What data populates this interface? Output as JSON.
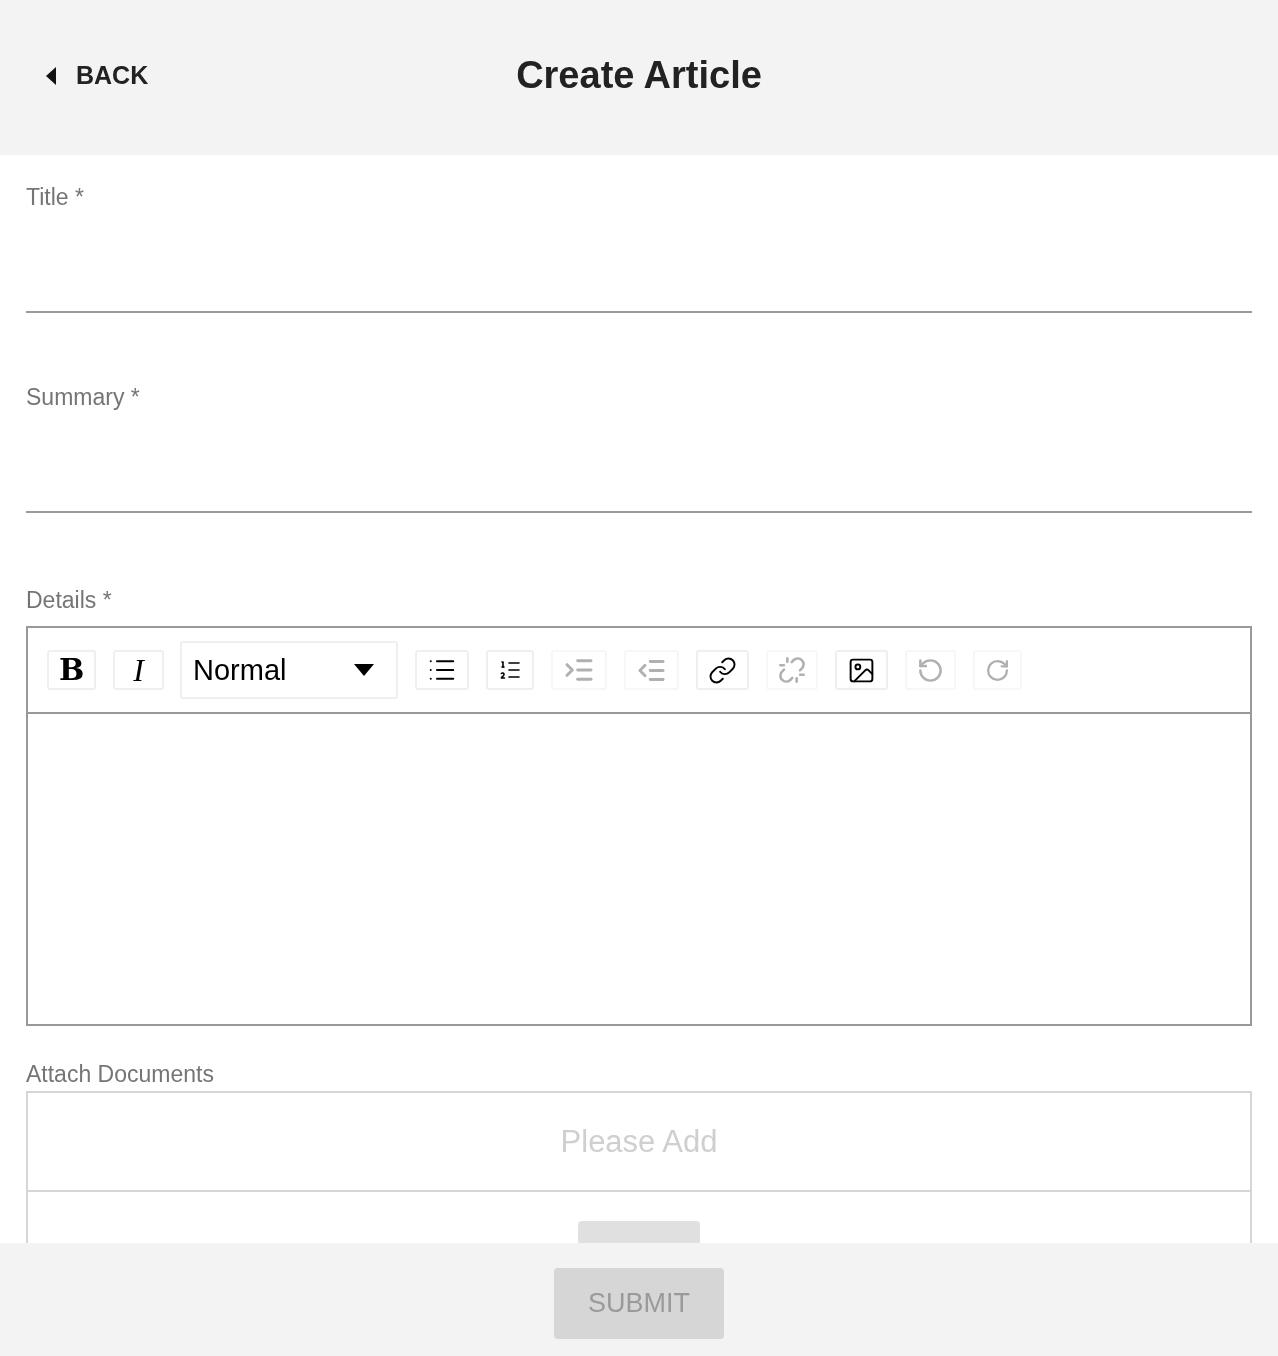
{
  "header": {
    "back": "BACK",
    "title": "Create Article"
  },
  "fields": [
    {
      "label": "Title *"
    },
    {
      "label": "Summary *"
    }
  ],
  "details": {
    "label": "Details *",
    "toolbar": [
      {
        "kind": "bold",
        "label": "B",
        "disabled": false
      },
      {
        "kind": "italic",
        "label": "I",
        "disabled": false
      },
      {
        "kind": "dropdown",
        "value": "Normal",
        "disabled": false
      },
      {
        "kind": "unordered",
        "disabled": false
      },
      {
        "kind": "ordered",
        "disabled": false
      },
      {
        "kind": "indent",
        "disabled": true
      },
      {
        "kind": "outdent",
        "disabled": true
      },
      {
        "kind": "link",
        "disabled": false
      },
      {
        "kind": "unlink",
        "disabled": true
      },
      {
        "kind": "image",
        "disabled": false
      },
      {
        "kind": "undo",
        "disabled": true
      },
      {
        "kind": "redo",
        "disabled": true
      }
    ]
  },
  "attachments": {
    "label": "Attach Documents",
    "empty_text": "Please Add"
  },
  "submit": {
    "label": "SUBMIT",
    "disabled": true
  }
}
